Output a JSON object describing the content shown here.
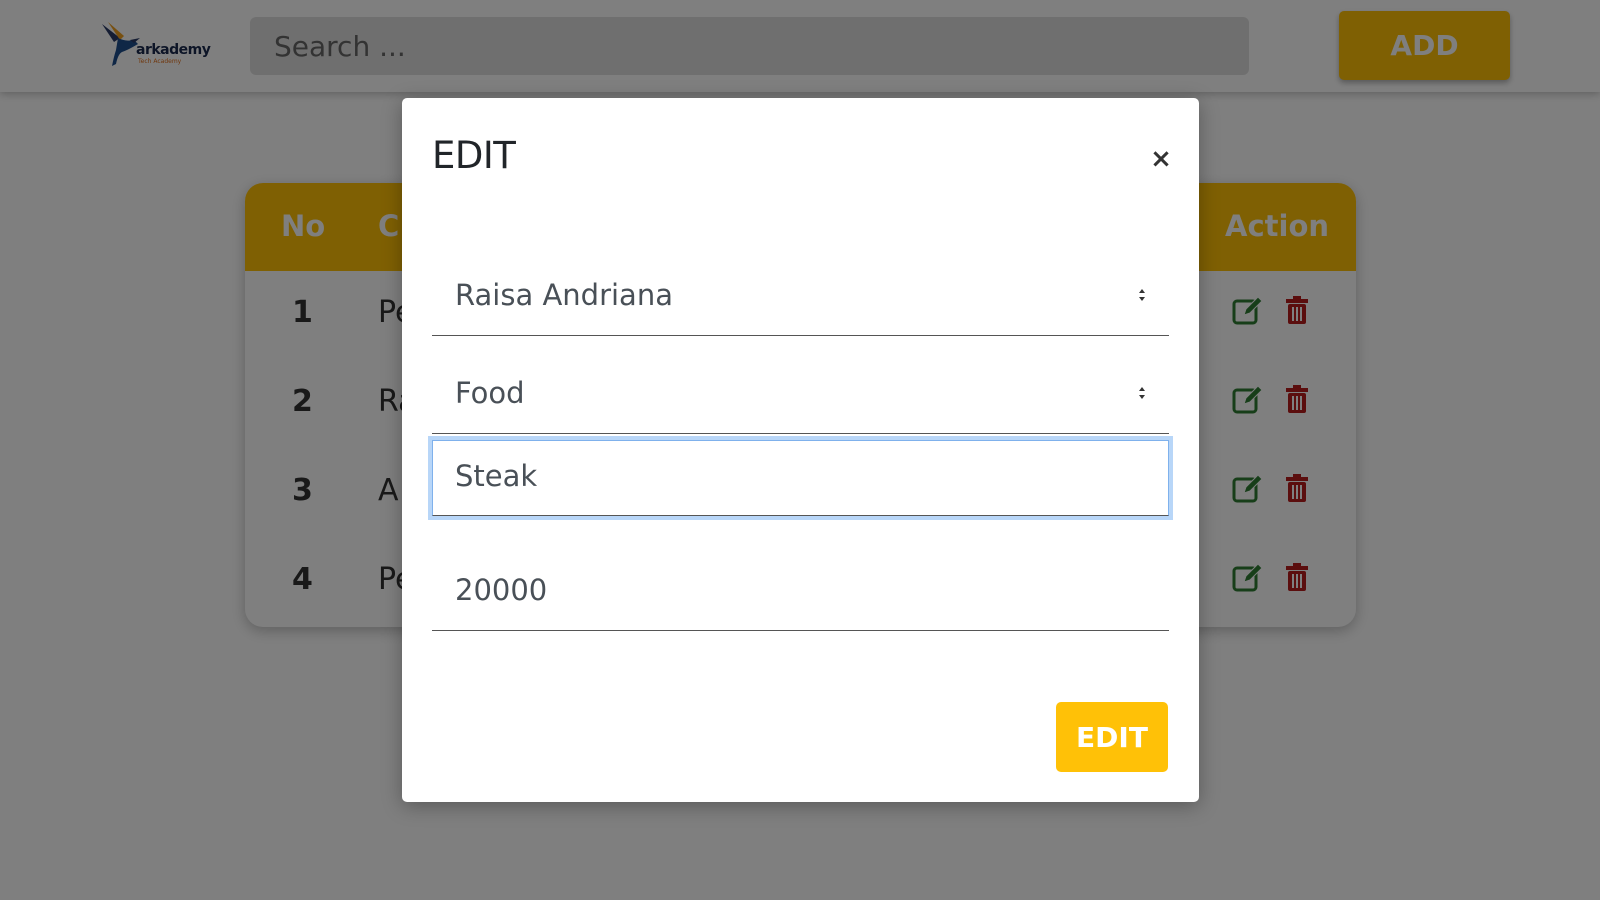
{
  "navbar": {
    "logo_text": "arkademy",
    "logo_subtext": "Tech Academy",
    "search_placeholder": "Search ...",
    "add_label": "ADD",
    "accent_color": "#ffc107"
  },
  "table": {
    "headers": {
      "no": "No",
      "c": "C",
      "action": "Action"
    },
    "rows": [
      {
        "no": "1",
        "name": "Pe"
      },
      {
        "no": "2",
        "name": "Ra"
      },
      {
        "no": "3",
        "name": "A"
      },
      {
        "no": "4",
        "name": "Pe"
      }
    ],
    "edit_icon": "edit-icon",
    "delete_icon": "trash-icon",
    "edit_icon_color": "#2e7d32",
    "delete_icon_color": "#b71c1c"
  },
  "modal": {
    "title": "EDIT",
    "close_symbol": "×",
    "cashier_select": "Raisa Andriana",
    "category_select": "Food",
    "product_name": "Steak",
    "price": "20000",
    "submit_label": "EDIT"
  }
}
